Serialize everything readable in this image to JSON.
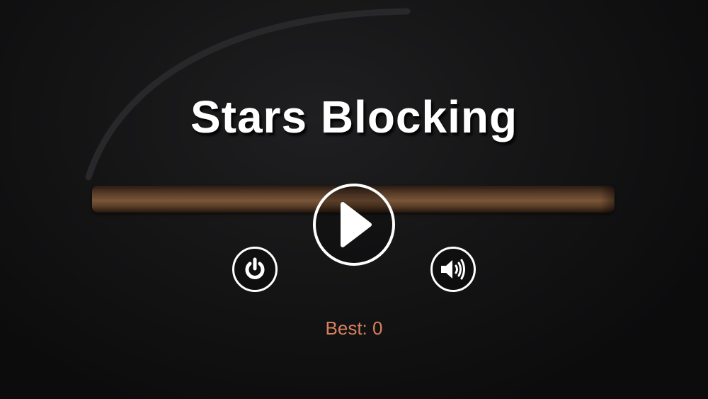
{
  "game": {
    "title": "Stars Blocking",
    "best_label": "Best:",
    "best_value": "0"
  },
  "buttons": {
    "play": "play-icon",
    "power": "power-icon",
    "sound": "speaker-icon"
  },
  "colors": {
    "background": "#0e0e0f",
    "title": "#ffffff",
    "best_text": "#d9805e",
    "bar": "#6b4a30"
  }
}
